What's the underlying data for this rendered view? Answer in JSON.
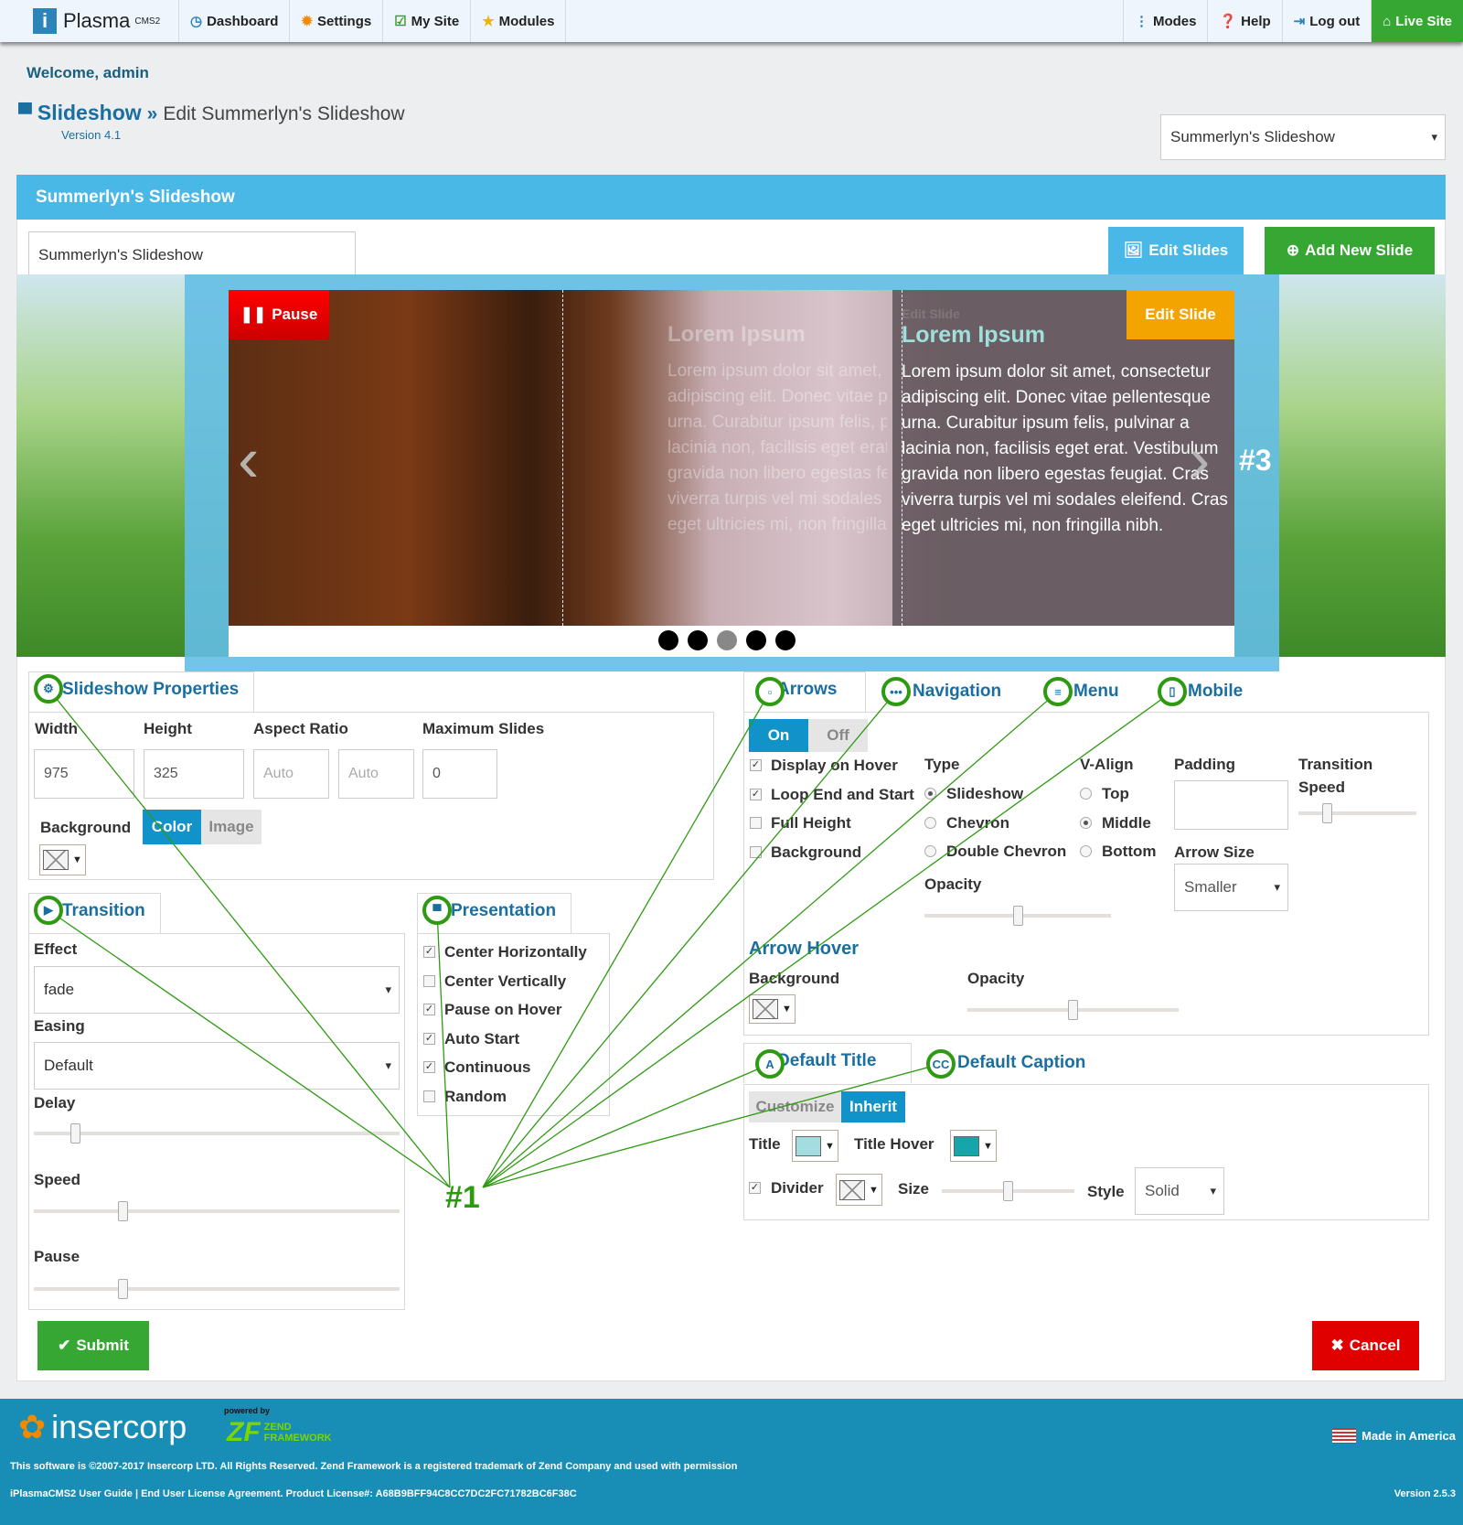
{
  "topbar": {
    "logo": "Plasma",
    "logo_sup": "CMS2",
    "items": [
      {
        "label": "Dashboard",
        "icon": "dashboard-icon"
      },
      {
        "label": "Settings",
        "icon": "gear-icon"
      },
      {
        "label": "My Site",
        "icon": "edit-icon"
      },
      {
        "label": "Modules",
        "icon": "star-icon"
      }
    ],
    "right": [
      {
        "label": "Modes",
        "icon": "dots-icon"
      },
      {
        "label": "Help",
        "icon": "help-icon"
      },
      {
        "label": "Log out",
        "icon": "logout-icon"
      },
      {
        "label": "Live Site",
        "icon": "home-icon"
      }
    ]
  },
  "welcome": "Welcome, admin",
  "breadcrumb": {
    "section": "Slideshow",
    "sep": "»",
    "page": "Edit Summerlyn's Slideshow",
    "version": "Version 4.1"
  },
  "slideshow_select": "Summerlyn's Slideshow",
  "header_title": "Summerlyn's Slideshow",
  "name_input": "Summerlyn's Slideshow",
  "buttons": {
    "edit_slides": "Edit Slides",
    "add_slide": "Add New Slide",
    "pause": "Pause",
    "edit_slide": "Edit Slide",
    "submit": "Submit",
    "cancel": "Cancel"
  },
  "slide": {
    "title": "Lorem Ipsum",
    "ghost_label": "Edit Slide",
    "body": "Lorem ipsum dolor sit amet, consectetur adipiscing elit. Donec vitae pellentesque urna. Curabitur ipsum felis, pulvinar a lacinia non, facilisis eget erat. Vestibulum gravida non libero egestas feugiat. Cras viverra turpis vel mi sodales eleifend. Cras eget ultricies mi, non fringilla nibh.",
    "dots": 5,
    "active_dot": 3
  },
  "annotations": {
    "a1": "#1",
    "a3": "#3"
  },
  "props": {
    "tab": "Slideshow Properties",
    "width_label": "Width",
    "height_label": "Height",
    "aspect_label": "Aspect Ratio",
    "max_label": "Maximum Slides",
    "width": "975",
    "height": "325",
    "aspect_w": "Auto",
    "aspect_h": "Auto",
    "max": "0",
    "bg_label": "Background",
    "bg_color": "Color",
    "bg_image": "Image"
  },
  "transition": {
    "tab": "Transition",
    "effect_label": "Effect",
    "effect": "fade",
    "easing_label": "Easing",
    "easing": "Default",
    "delay_label": "Delay",
    "speed_label": "Speed",
    "pause_label": "Pause",
    "delay_pct": 10,
    "speed_pct": 23,
    "pause_pct": 23
  },
  "presentation": {
    "tab": "Presentation",
    "items": [
      {
        "label": "Center Horizontally",
        "checked": true
      },
      {
        "label": "Center Vertically",
        "checked": false
      },
      {
        "label": "Pause on Hover",
        "checked": true
      },
      {
        "label": "Auto Start",
        "checked": true
      },
      {
        "label": "Continuous",
        "checked": true
      },
      {
        "label": "Random",
        "checked": false
      }
    ]
  },
  "arrows": {
    "tabs": [
      "Arrows",
      "Navigation",
      "Menu",
      "Mobile"
    ],
    "on": "On",
    "off": "Off",
    "checks": [
      {
        "label": "Display on Hover",
        "checked": true
      },
      {
        "label": "Loop End and Start",
        "checked": true
      },
      {
        "label": "Full Height",
        "checked": false
      },
      {
        "label": "Background",
        "checked": false
      }
    ],
    "type_label": "Type",
    "types": [
      {
        "label": "Slideshow",
        "on": true
      },
      {
        "label": "Chevron",
        "on": false
      },
      {
        "label": "Double Chevron",
        "on": false
      }
    ],
    "valign_label": "V-Align",
    "valigns": [
      {
        "label": "Top",
        "on": false
      },
      {
        "label": "Middle",
        "on": true
      },
      {
        "label": "Bottom",
        "on": false
      }
    ],
    "padding_label": "Padding",
    "padding": "",
    "tspeed_label1": "Transition",
    "tspeed_label2": "Speed",
    "size_label": "Arrow Size",
    "size": "Smaller",
    "opacity_label": "Opacity",
    "hover_title": "Arrow Hover",
    "hover_bg_label": "Background",
    "hover_opacity_label": "Opacity"
  },
  "deftitle": {
    "tabs": [
      "Default Title",
      "Default Caption"
    ],
    "customize": "Customize",
    "inherit": "Inherit",
    "title_label": "Title",
    "title_hover_label": "Title Hover",
    "title_color": "#a3dde0",
    "title_hover_color": "#14a6a8",
    "divider_label": "Divider",
    "size_label": "Size",
    "style_label": "Style",
    "style": "Solid"
  },
  "footer": {
    "brand": "insercorp",
    "powered": "powered by",
    "zend": "ZEND",
    "framework": "FRAMEWORK",
    "made": "Made in America",
    "copyright": "This software is ©2007-2017 Insercorp LTD. All Rights Reserved. Zend Framework is a registered trademark of Zend Company and used with permission",
    "links": "iPlasmaCMS2 User Guide | End User License Agreement. Product License#: A68B9BFF94C8CC7DC2FC71782BC6F38C",
    "version": "Version 2.5.3"
  },
  "colors": {
    "header": "#4ab8e6",
    "green": "#36a733",
    "red": "#e00000",
    "orange": "#f4a400",
    "footer": "#188db5",
    "annot": "#2e9a12"
  }
}
